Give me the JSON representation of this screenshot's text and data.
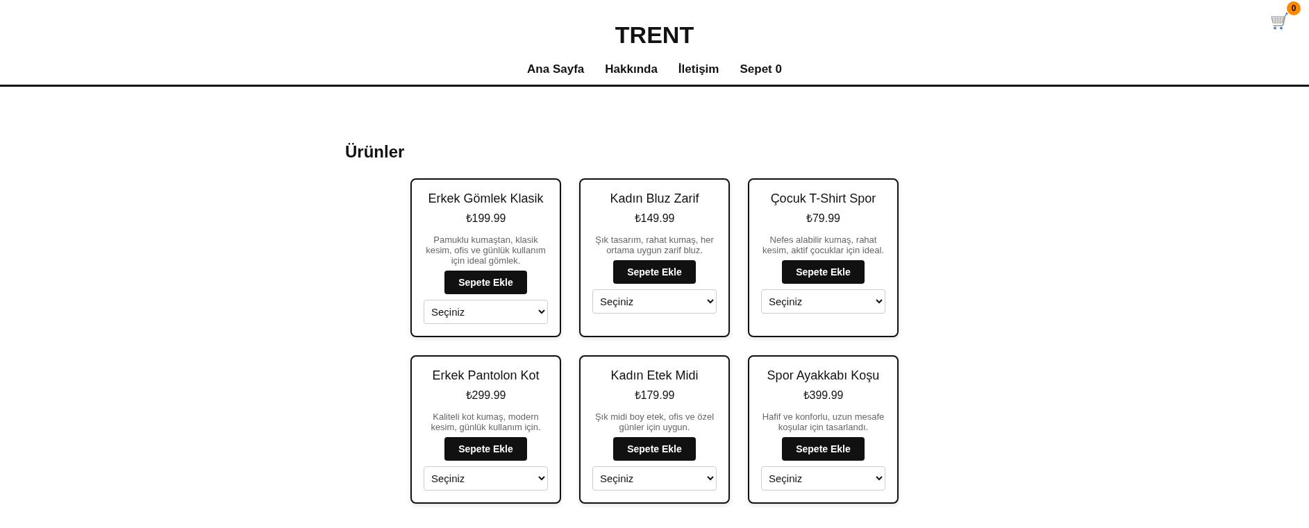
{
  "header": {
    "title": "TRENT",
    "nav": [
      "Ana Sayfa",
      "Hakkında",
      "İletişim",
      "Sepet 0"
    ],
    "cart": {
      "count": "0"
    }
  },
  "products": {
    "heading": "Ürünler",
    "items": [
      {
        "name": "Erkek Gömlek Klasik",
        "price": "₺199.99",
        "description": "Pamuklu kumaştan, klasik kesim, ofis ve günlük kullanım için ideal gömlek.",
        "button": "Sepete Ekle",
        "select": "Seçiniz"
      },
      {
        "name": "Kadın Bluz Zarif",
        "price": "₺149.99",
        "description": "Şık tasarım, rahat kumaş, her ortama uygun zarif bluz.",
        "button": "Sepete Ekle",
        "select": "Seçiniz"
      },
      {
        "name": "Çocuk T-Shirt Spor",
        "price": "₺79.99",
        "description": "Nefes alabilir kumaş, rahat kesim, aktif çocuklar için ideal.",
        "button": "Sepete Ekle",
        "select": "Seçiniz"
      },
      {
        "name": "Erkek Pantolon Kot",
        "price": "₺299.99",
        "description": "Kaliteli kot kumaş, modern kesim, günlük kullanım için.",
        "button": "Sepete Ekle",
        "select": "Seçiniz"
      },
      {
        "name": "Kadın Etek Midi",
        "price": "₺179.99",
        "description": "Şık midi boy etek, ofis ve özel günler için uygun.",
        "button": "Sepete Ekle",
        "select": "Seçiniz"
      },
      {
        "name": "Spor Ayakkabı Koşu",
        "price": "₺399.99",
        "description": "Hafif ve konforlu, uzun mesafe koşular için tasarlandı.",
        "button": "Sepete Ekle",
        "select": "Seçiniz"
      }
    ]
  }
}
